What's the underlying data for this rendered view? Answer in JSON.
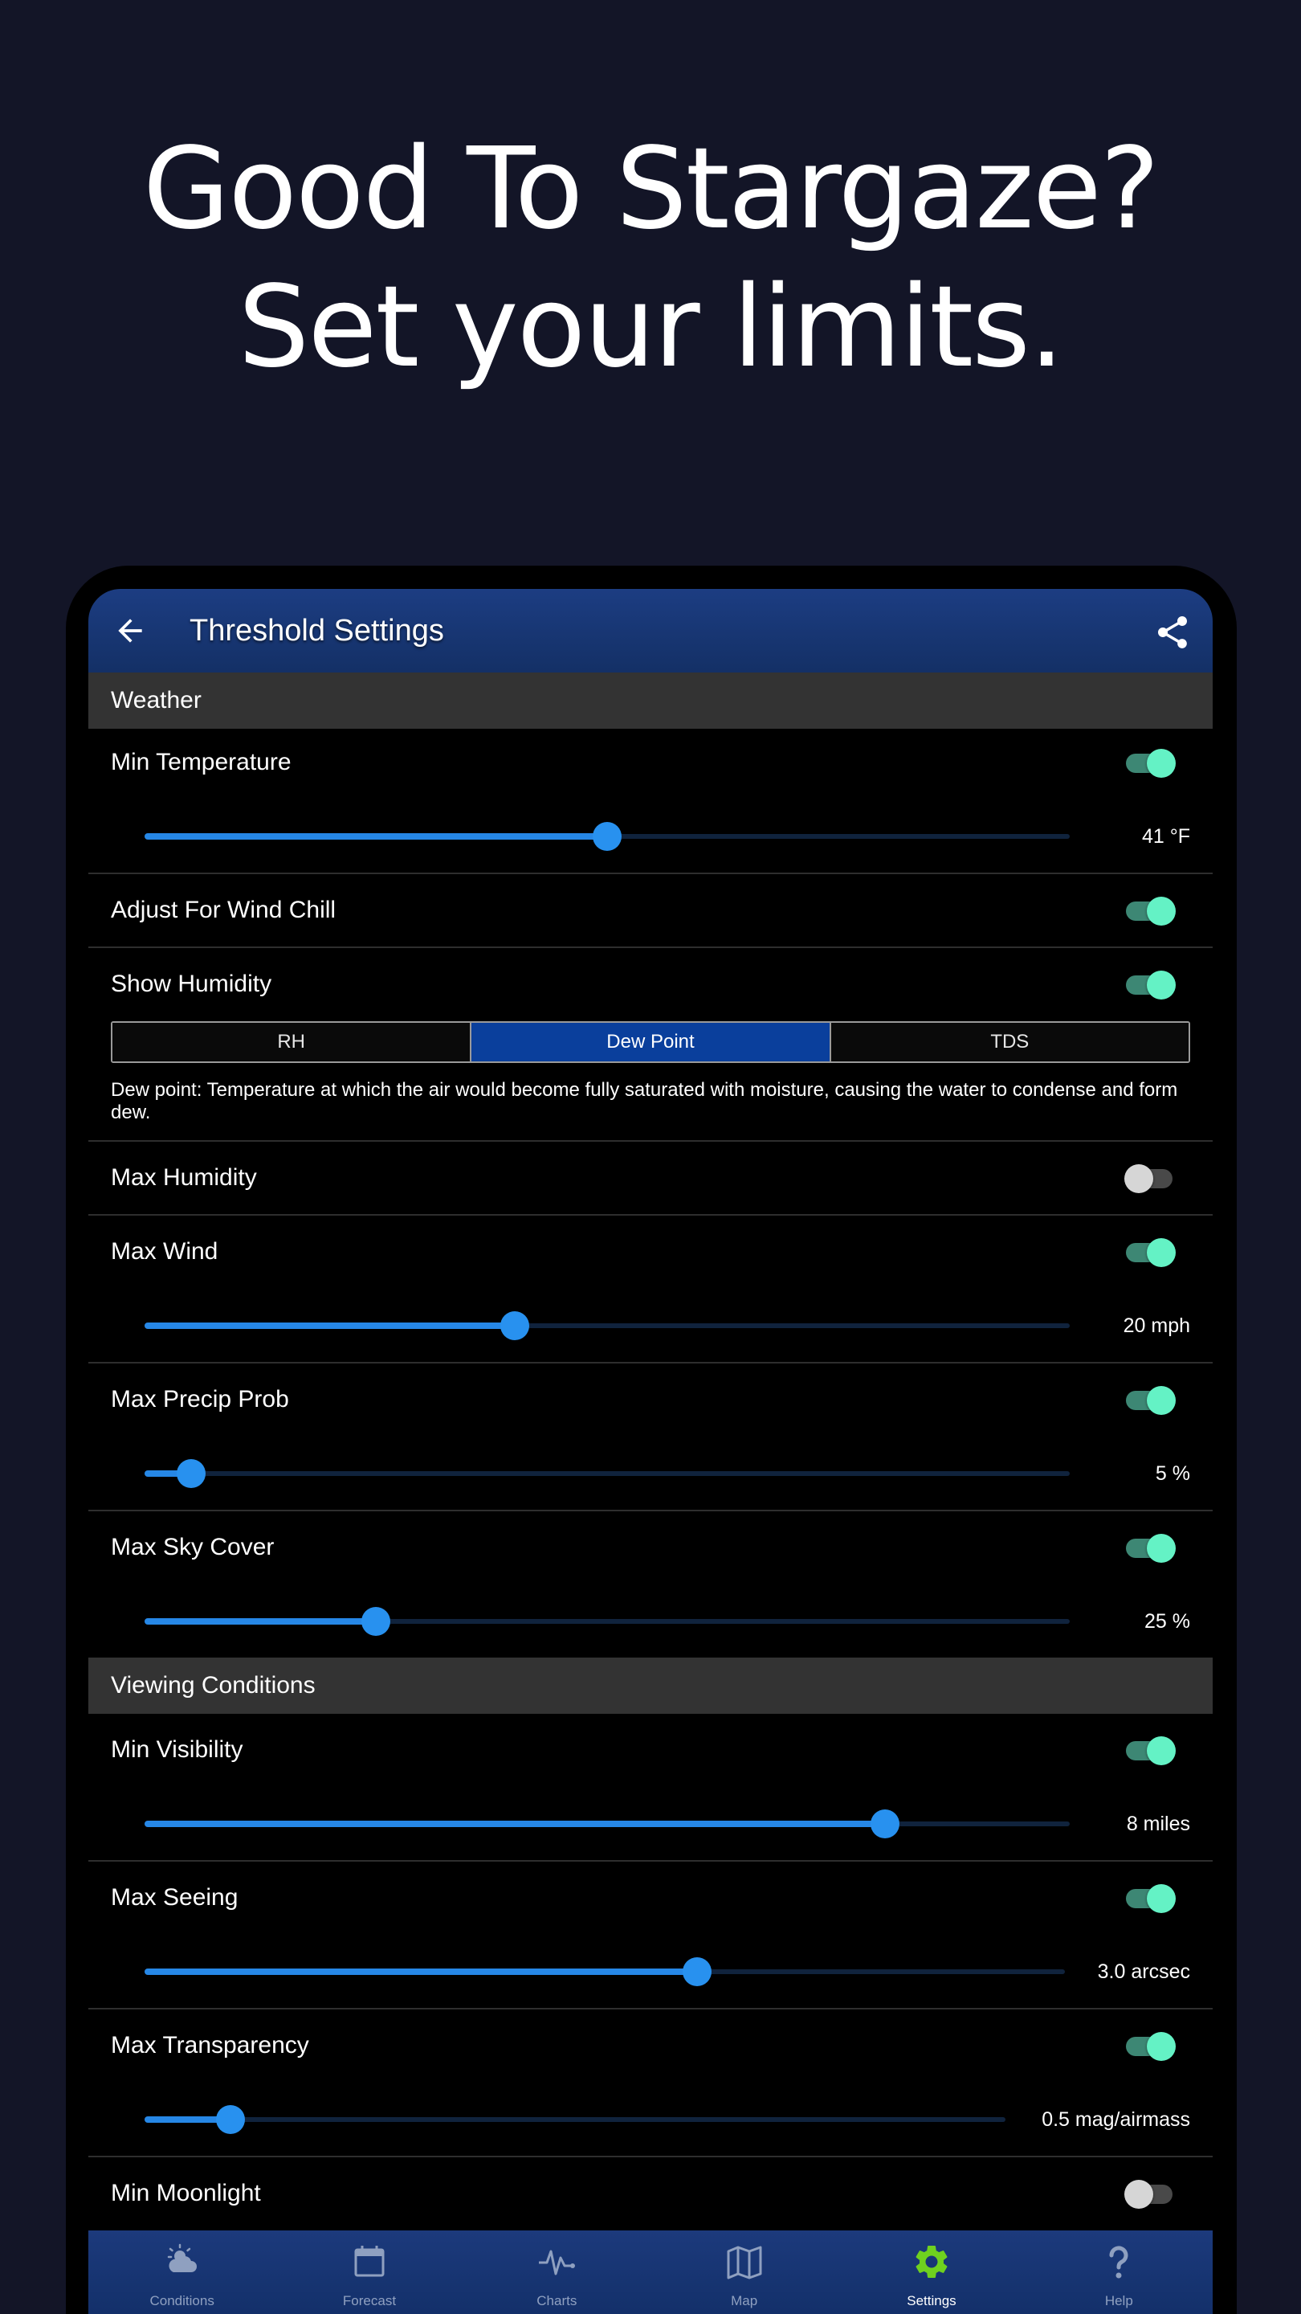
{
  "headline": {
    "line1": "Good To Stargaze?",
    "line2": "Set your limits."
  },
  "app_bar": {
    "title": "Threshold Settings"
  },
  "sections": {
    "weather": "Weather",
    "viewing": "Viewing Conditions"
  },
  "settings": {
    "min_temperature": {
      "label": "Min Temperature",
      "enabled": true,
      "value": "41 °F",
      "level": 0.5
    },
    "wind_chill": {
      "label": "Adjust For Wind Chill",
      "enabled": true
    },
    "show_humidity": {
      "label": "Show Humidity",
      "enabled": true
    },
    "humidity_mode": {
      "options": [
        "RH",
        "Dew Point",
        "TDS"
      ],
      "selected": "Dew Point"
    },
    "dew_point_description": "Dew point: Temperature at which the air would become fully saturated with moisture, causing the water to condense and form dew.",
    "max_humidity": {
      "label": "Max Humidity",
      "enabled": false
    },
    "max_wind": {
      "label": "Max Wind",
      "enabled": true,
      "value": "20 mph",
      "level": 0.4
    },
    "max_precip_prob": {
      "label": "Max Precip Prob",
      "enabled": true,
      "value": "5 %",
      "level": 0.05
    },
    "max_sky_cover": {
      "label": "Max Sky Cover",
      "enabled": true,
      "value": "25 %",
      "level": 0.25
    },
    "min_visibility": {
      "label": "Min Visibility",
      "enabled": true,
      "value": "8 miles",
      "level": 0.8
    },
    "max_seeing": {
      "label": "Max Seeing",
      "enabled": true,
      "value": "3.0 arcsec",
      "level": 0.6
    },
    "max_transparency": {
      "label": "Max Transparency",
      "enabled": true,
      "value": "0.5 mag/airmass",
      "level": 0.1
    },
    "min_moonlight": {
      "label": "Min Moonlight",
      "enabled": false
    }
  },
  "bottom_nav": {
    "items": [
      {
        "label": "Conditions",
        "icon": "cloud-sun-icon"
      },
      {
        "label": "Forecast",
        "icon": "calendar-icon"
      },
      {
        "label": "Charts",
        "icon": "pulse-chart-icon"
      },
      {
        "label": "Map",
        "icon": "map-icon"
      },
      {
        "label": "Settings",
        "icon": "gear-icon"
      },
      {
        "label": "Help",
        "icon": "question-mark-icon"
      }
    ],
    "active": "Settings"
  },
  "colors": {
    "background": "#131527",
    "accent_slider": "#2891ef",
    "toggle_on": "#64f2c5",
    "app_bar": "#1c3d82",
    "active_nav_icon": "#6fd11f",
    "segment_active": "#0a3f9c"
  }
}
